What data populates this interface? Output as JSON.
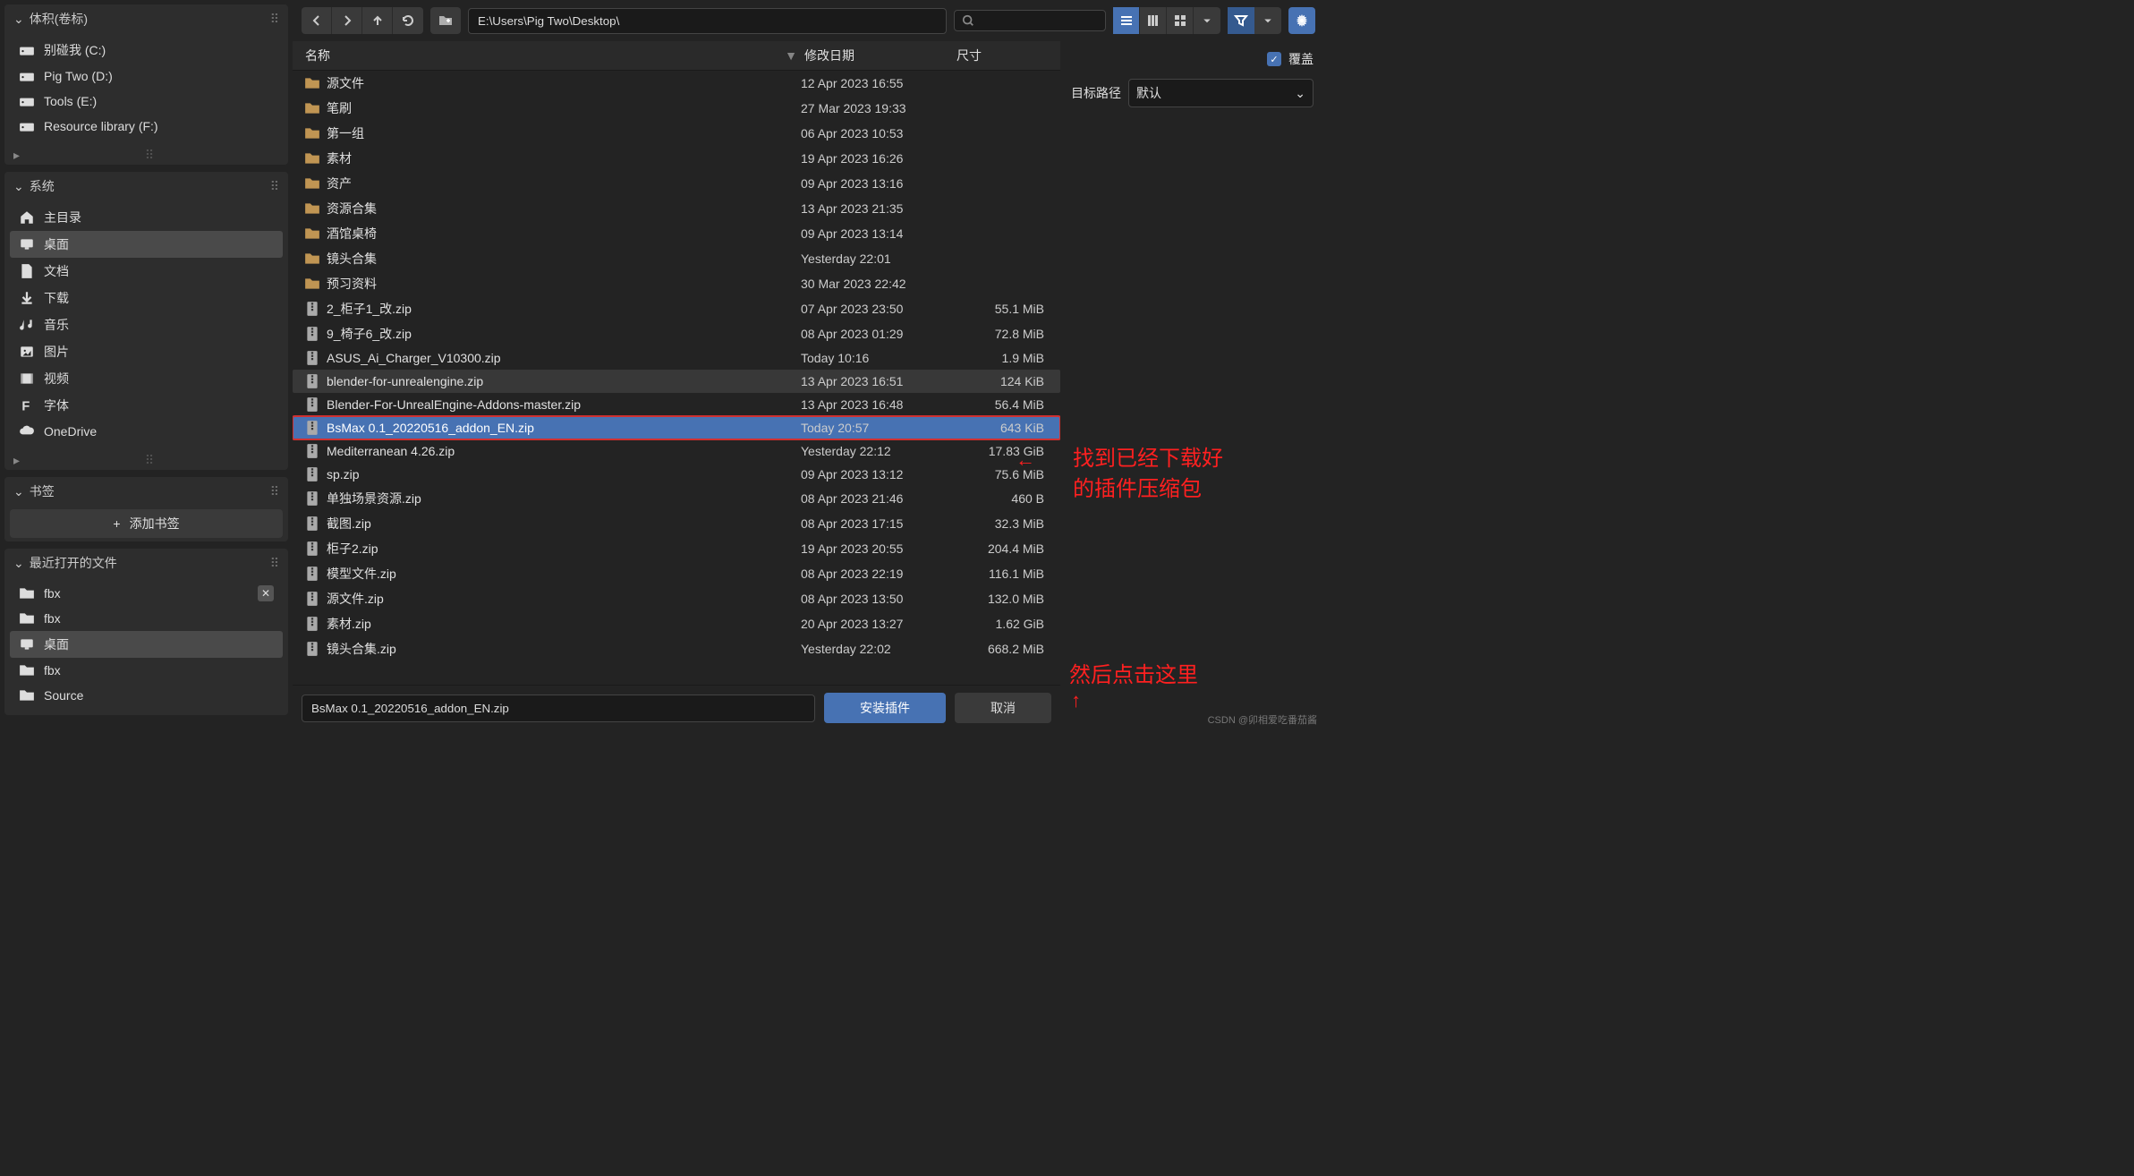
{
  "sidebar": {
    "volumes": {
      "title": "体积(卷标)",
      "items": [
        {
          "label": "别碰我 (C:)"
        },
        {
          "label": "Pig Two (D:)"
        },
        {
          "label": "Tools (E:)"
        },
        {
          "label": "Resource library (F:)"
        }
      ]
    },
    "system": {
      "title": "系统",
      "items": [
        {
          "label": "主目录",
          "icon": "home"
        },
        {
          "label": "桌面",
          "icon": "desktop",
          "active": true
        },
        {
          "label": "文档",
          "icon": "document"
        },
        {
          "label": "下载",
          "icon": "download"
        },
        {
          "label": "音乐",
          "icon": "music"
        },
        {
          "label": "图片",
          "icon": "image"
        },
        {
          "label": "视频",
          "icon": "video"
        },
        {
          "label": "字体",
          "icon": "font"
        },
        {
          "label": "OneDrive",
          "icon": "cloud"
        }
      ]
    },
    "bookmarks": {
      "title": "书签",
      "add_label": "添加书签"
    },
    "recent": {
      "title": "最近打开的文件",
      "items": [
        {
          "label": "fbx",
          "icon": "folder",
          "closable": true
        },
        {
          "label": "fbx",
          "icon": "folder"
        },
        {
          "label": "桌面",
          "icon": "desktop",
          "active": true
        },
        {
          "label": "fbx",
          "icon": "folder"
        },
        {
          "label": "Source",
          "icon": "folder"
        }
      ]
    }
  },
  "toolbar": {
    "path": "E:\\Users\\Pig Two\\Desktop\\",
    "search_placeholder": ""
  },
  "columns": {
    "name": "名称",
    "date": "修改日期",
    "size": "尺寸"
  },
  "files": [
    {
      "name": "源文件",
      "date": "12 Apr 2023 16:55",
      "size": "",
      "type": "folder"
    },
    {
      "name": "笔刷",
      "date": "27 Mar 2023 19:33",
      "size": "",
      "type": "folder"
    },
    {
      "name": "第一组",
      "date": "06 Apr 2023 10:53",
      "size": "",
      "type": "folder"
    },
    {
      "name": "素材",
      "date": "19 Apr 2023 16:26",
      "size": "",
      "type": "folder"
    },
    {
      "name": "资产",
      "date": "09 Apr 2023 13:16",
      "size": "",
      "type": "folder"
    },
    {
      "name": "资源合集",
      "date": "13 Apr 2023 21:35",
      "size": "",
      "type": "folder"
    },
    {
      "name": "酒馆桌椅",
      "date": "09 Apr 2023 13:14",
      "size": "",
      "type": "folder"
    },
    {
      "name": "镜头合集",
      "date": "Yesterday 22:01",
      "size": "",
      "type": "folder"
    },
    {
      "name": "预习资料",
      "date": "30 Mar 2023 22:42",
      "size": "",
      "type": "folder"
    },
    {
      "name": "2_柜子1_改.zip",
      "date": "07 Apr 2023 23:50",
      "size": "55.1 MiB",
      "type": "zip"
    },
    {
      "name": "9_椅子6_改.zip",
      "date": "08 Apr 2023 01:29",
      "size": "72.8 MiB",
      "type": "zip"
    },
    {
      "name": "ASUS_Ai_Charger_V10300.zip",
      "date": "Today 10:16",
      "size": "1.9 MiB",
      "type": "zip"
    },
    {
      "name": "blender-for-unrealengine.zip",
      "date": "13 Apr 2023 16:51",
      "size": "124 KiB",
      "type": "zip",
      "hover": true
    },
    {
      "name": "Blender-For-UnrealEngine-Addons-master.zip",
      "date": "13 Apr 2023 16:48",
      "size": "56.4 MiB",
      "type": "zip"
    },
    {
      "name": "BsMax 0.1_20220516_addon_EN.zip",
      "date": "Today 20:57",
      "size": "643 KiB",
      "type": "zip",
      "selected": true
    },
    {
      "name": "Mediterranean 4.26.zip",
      "date": "Yesterday 22:12",
      "size": "17.83 GiB",
      "type": "zip"
    },
    {
      "name": "sp.zip",
      "date": "09 Apr 2023 13:12",
      "size": "75.6 MiB",
      "type": "zip"
    },
    {
      "name": "单独场景资源.zip",
      "date": "08 Apr 2023 21:46",
      "size": "460 B",
      "type": "zip"
    },
    {
      "name": "截图.zip",
      "date": "08 Apr 2023 17:15",
      "size": "32.3 MiB",
      "type": "zip"
    },
    {
      "name": "柜子2.zip",
      "date": "19 Apr 2023 20:55",
      "size": "204.4 MiB",
      "type": "zip"
    },
    {
      "name": "模型文件.zip",
      "date": "08 Apr 2023 22:19",
      "size": "116.1 MiB",
      "type": "zip"
    },
    {
      "name": "源文件.zip",
      "date": "08 Apr 2023 13:50",
      "size": "132.0 MiB",
      "type": "zip"
    },
    {
      "name": "素材.zip",
      "date": "20 Apr 2023 13:27",
      "size": "1.62 GiB",
      "type": "zip"
    },
    {
      "name": "镜头合集.zip",
      "date": "Yesterday 22:02",
      "size": "668.2 MiB",
      "type": "zip"
    }
  ],
  "options": {
    "overwrite_label": "覆盖",
    "target_path_label": "目标路径",
    "target_path_value": "默认"
  },
  "annotations": {
    "line1": "找到已经下载好",
    "line2": "的插件压缩包",
    "line3": "然后点击这里"
  },
  "bottom": {
    "filename": "BsMax 0.1_20220516_addon_EN.zip",
    "install": "安装插件",
    "cancel": "取消"
  },
  "watermark": "CSDN @卯相爱吃番茄酱"
}
